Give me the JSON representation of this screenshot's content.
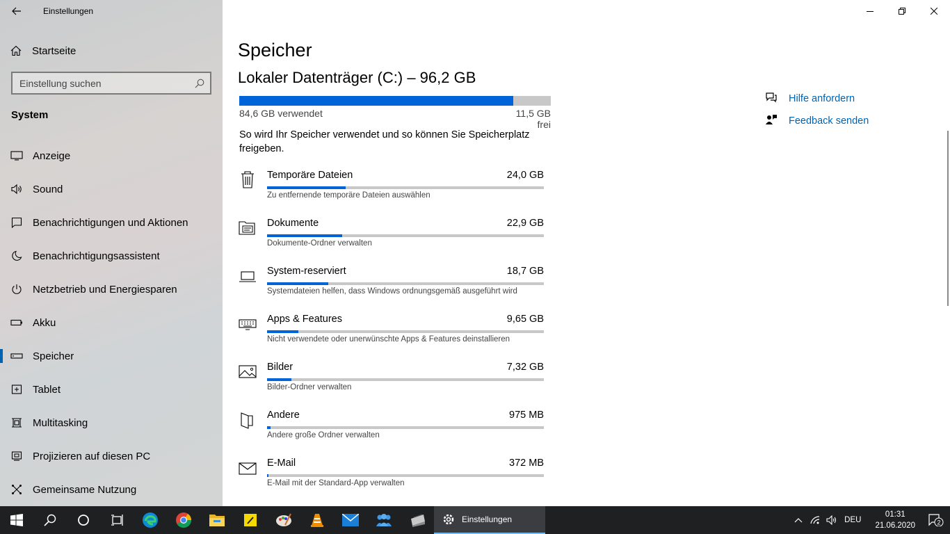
{
  "window": {
    "title": "Einstellungen"
  },
  "sidebar": {
    "home_label": "Startseite",
    "search_placeholder": "Einstellung suchen",
    "section": "System",
    "items": [
      {
        "label": "Anzeige",
        "icon": "monitor-icon"
      },
      {
        "label": "Sound",
        "icon": "speaker-icon"
      },
      {
        "label": "Benachrichtigungen und Aktionen",
        "icon": "notification-icon"
      },
      {
        "label": "Benachrichtigungsassistent",
        "icon": "moon-icon"
      },
      {
        "label": "Netzbetrieb und Energiesparen",
        "icon": "power-icon"
      },
      {
        "label": "Akku",
        "icon": "battery-icon"
      },
      {
        "label": "Speicher",
        "icon": "storage-icon",
        "active": true
      },
      {
        "label": "Tablet",
        "icon": "tablet-icon"
      },
      {
        "label": "Multitasking",
        "icon": "multitasking-icon"
      },
      {
        "label": "Projizieren auf diesen PC",
        "icon": "project-icon"
      },
      {
        "label": "Gemeinsame Nutzung",
        "icon": "share-icon"
      }
    ]
  },
  "main": {
    "page_title": "Speicher",
    "drive_title": "Lokaler Datenträger (C:) – 96,2 GB",
    "drive_used_fraction": 0.88,
    "used_label": "84,6 GB verwendet",
    "free_label": "11,5 GB frei",
    "description": "So wird Ihr Speicher verwendet und so können Sie Speicherplatz freigeben.",
    "categories": [
      {
        "name": "Temporäre Dateien",
        "size": "24,0 GB",
        "sub": "Zu entfernende temporäre Dateien auswählen",
        "fraction": 0.285,
        "icon": "trash-icon"
      },
      {
        "name": "Dokumente",
        "size": "22,9 GB",
        "sub": "Dokumente-Ordner verwalten",
        "fraction": 0.272,
        "icon": "documents-folder-icon"
      },
      {
        "name": "System-reserviert",
        "size": "18,7 GB",
        "sub": "Systemdateien helfen, dass Windows ordnungsgemäß ausgeführt wird",
        "fraction": 0.222,
        "icon": "laptop-icon"
      },
      {
        "name": "Apps & Features",
        "size": "9,65 GB",
        "sub": "Nicht verwendete oder unerwünschte Apps & Features deinstallieren",
        "fraction": 0.114,
        "icon": "keyboard-icon"
      },
      {
        "name": "Bilder",
        "size": "7,32 GB",
        "sub": "Bilder-Ordner verwalten",
        "fraction": 0.087,
        "icon": "picture-icon"
      },
      {
        "name": "Andere",
        "size": "975 MB",
        "sub": "Andere große Ordner verwalten",
        "fraction": 0.012,
        "icon": "folder-other-icon"
      },
      {
        "name": "E-Mail",
        "size": "372 MB",
        "sub": "E-Mail mit der Standard-App verwalten",
        "fraction": 0.005,
        "icon": "mail-icon"
      }
    ],
    "help": {
      "help_label": "Hilfe anfordern",
      "feedback_label": "Feedback senden"
    }
  },
  "taskbar": {
    "active_app": "Einstellungen",
    "language": "DEU",
    "time": "01:31",
    "date": "21.06.2020",
    "notification_count": "2"
  }
}
